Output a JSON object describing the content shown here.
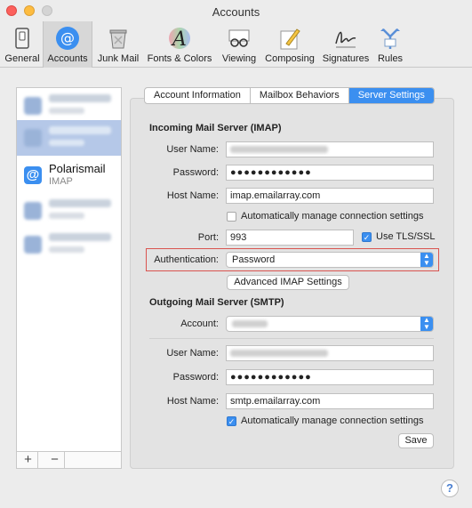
{
  "window": {
    "title": "Accounts"
  },
  "toolbar": {
    "items": [
      {
        "label": "General",
        "icon": "general-switch-icon"
      },
      {
        "label": "Accounts",
        "icon": "at-sign-icon"
      },
      {
        "label": "Junk Mail",
        "icon": "trash-can-icon"
      },
      {
        "label": "Fonts & Colors",
        "icon": "font-a-icon"
      },
      {
        "label": "Viewing",
        "icon": "glasses-icon"
      },
      {
        "label": "Composing",
        "icon": "pencil-notepad-icon"
      },
      {
        "label": "Signatures",
        "icon": "signature-icon"
      },
      {
        "label": "Rules",
        "icon": "rules-arrows-icon"
      }
    ]
  },
  "accounts": {
    "focused": {
      "name": "Polarismail",
      "type": "IMAP",
      "icon_char": "@"
    }
  },
  "list_footer": {
    "add": "+",
    "remove": "−"
  },
  "tabs": [
    {
      "label": "Account Information"
    },
    {
      "label": "Mailbox Behaviors"
    },
    {
      "label": "Server Settings"
    }
  ],
  "incoming": {
    "heading": "Incoming Mail Server (IMAP)",
    "user_name_label": "User Name:",
    "password_label": "Password:",
    "password_value": "●●●●●●●●●●●●",
    "host_name_label": "Host Name:",
    "host_name_value": "imap.emailarray.com",
    "auto_manage_label": "Automatically manage connection settings",
    "port_label": "Port:",
    "port_value": "993",
    "tls_label": "Use TLS/SSL",
    "auth_label": "Authentication:",
    "auth_value": "Password",
    "advanced_button": "Advanced IMAP Settings"
  },
  "outgoing": {
    "heading": "Outgoing Mail Server (SMTP)",
    "account_label": "Account:",
    "user_name_label": "User Name:",
    "password_label": "Password:",
    "password_value": "●●●●●●●●●●●●",
    "host_name_label": "Host Name:",
    "host_name_value": "smtp.emailarray.com",
    "auto_manage_label": "Automatically manage connection settings",
    "save_button": "Save"
  },
  "help": "?",
  "colors": {
    "accent": "#3b8ff0",
    "highlight_border": "#d9534f"
  }
}
